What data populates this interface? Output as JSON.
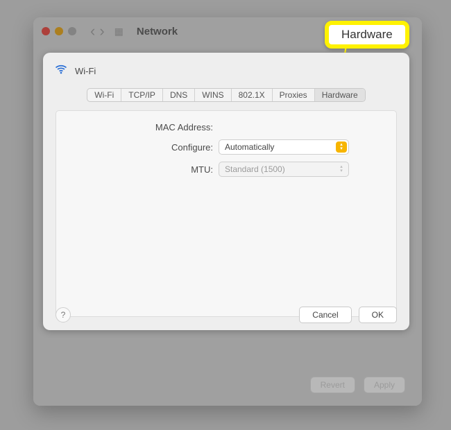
{
  "window": {
    "title": "Network",
    "footer_buttons": {
      "revert": "Revert",
      "apply": "Apply"
    }
  },
  "callout": {
    "label": "Hardware"
  },
  "sheet": {
    "interface": "Wi-Fi",
    "tabs": [
      "Wi-Fi",
      "TCP/IP",
      "DNS",
      "WINS",
      "802.1X",
      "Proxies",
      "Hardware"
    ],
    "fields": {
      "mac_label": "MAC Address:",
      "mac_value": "",
      "configure_label": "Configure:",
      "configure_value": "Automatically",
      "mtu_label": "MTU:",
      "mtu_value": "Standard  (1500)"
    },
    "buttons": {
      "help": "?",
      "cancel": "Cancel",
      "ok": "OK"
    }
  }
}
